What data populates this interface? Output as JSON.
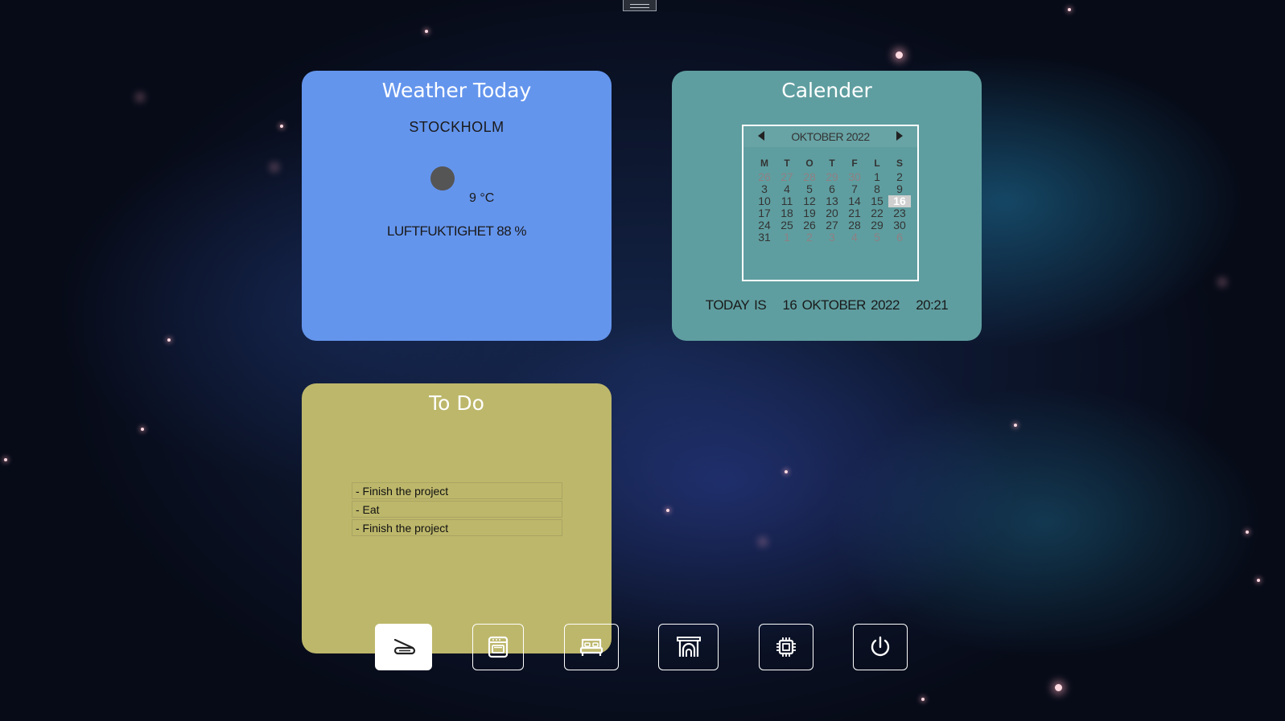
{
  "weather": {
    "title": "Weather Today",
    "city": "STOCKHOLM",
    "temperature": "9 °C",
    "humidity": "LUFTFUKTIGHET 88 %",
    "icon": "weather-icon"
  },
  "calendar": {
    "title": "Calender",
    "month_label": "OKTOBER 2022",
    "weekdays": [
      "M",
      "T",
      "O",
      "T",
      "F",
      "L",
      "S"
    ],
    "weeks": [
      [
        "26",
        "27",
        "28",
        "29",
        "30",
        "1",
        "2"
      ],
      [
        "3",
        "4",
        "5",
        "6",
        "7",
        "8",
        "9"
      ],
      [
        "10",
        "11",
        "12",
        "13",
        "14",
        "15",
        "16"
      ],
      [
        "17",
        "18",
        "19",
        "20",
        "21",
        "22",
        "23"
      ],
      [
        "24",
        "25",
        "26",
        "27",
        "28",
        "29",
        "30"
      ],
      [
        "31",
        "1",
        "2",
        "3",
        "4",
        "5",
        "6"
      ]
    ],
    "selected_day": "16",
    "today_label": "TODAY IS",
    "today_date": "16 OKTOBER 2022",
    "time": "20:21"
  },
  "todo": {
    "title": "To Do",
    "items": [
      "- Finish the project",
      "- Eat",
      "- Finish the project"
    ]
  },
  "dock": {
    "buttons": [
      "vacuum-icon",
      "oven-icon",
      "bed-icon",
      "fireplace-icon",
      "cpu-icon",
      "power-icon"
    ],
    "active": "vacuum-icon"
  },
  "colors": {
    "weather_card": "#6495ed",
    "calendar_card": "#5f9ea0",
    "todo_card": "#bdb76b"
  }
}
